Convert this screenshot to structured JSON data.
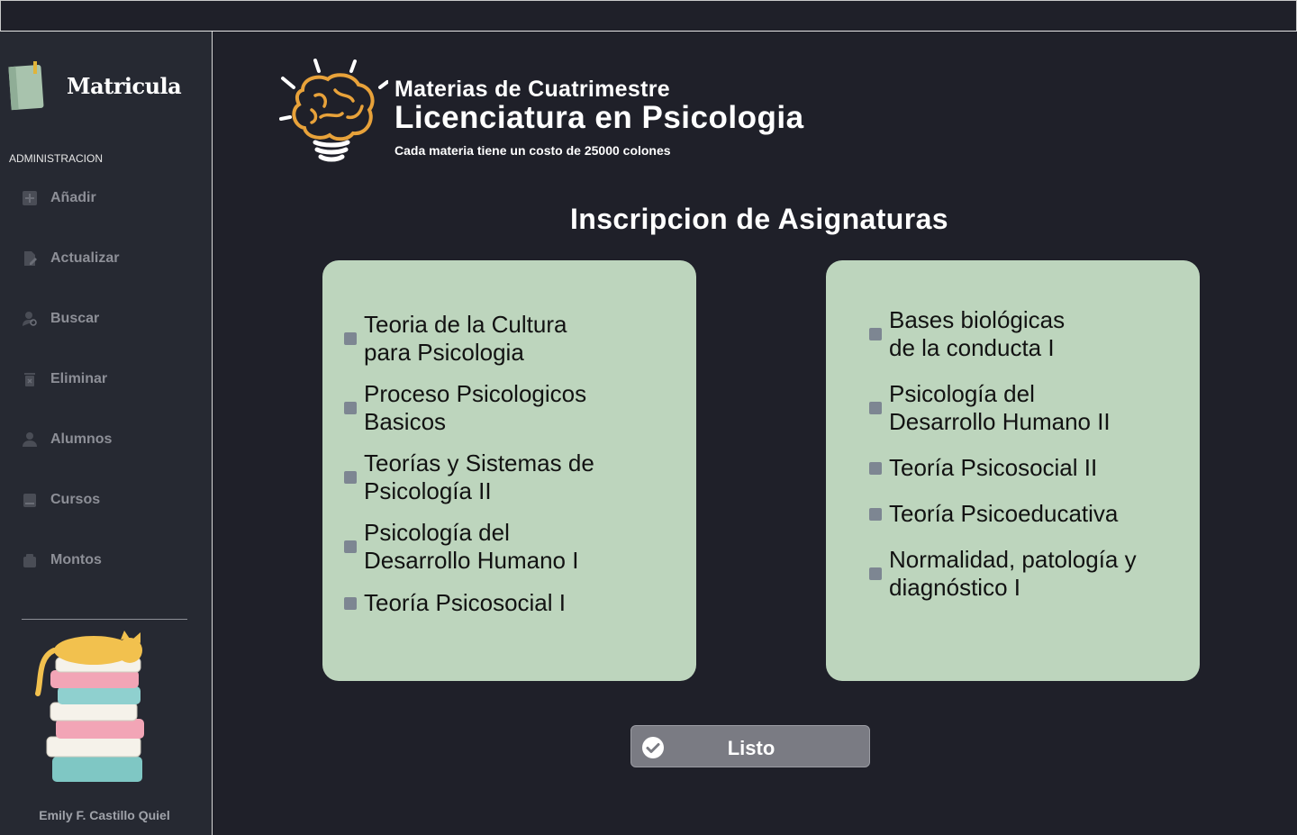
{
  "sidebar": {
    "brand": "Matricula",
    "section": "ADMINISTRACION",
    "items": [
      {
        "label": "Añadir",
        "icon": "add-icon"
      },
      {
        "label": "Actualizar",
        "icon": "edit-document-icon"
      },
      {
        "label": "Buscar",
        "icon": "user-search-icon"
      },
      {
        "label": "Eliminar",
        "icon": "trash-icon"
      },
      {
        "label": "Alumnos",
        "icon": "user-icon"
      },
      {
        "label": "Cursos",
        "icon": "book-icon"
      },
      {
        "label": "Montos",
        "icon": "wallet-icon"
      }
    ],
    "author": "Emily F. Castillo Quiel"
  },
  "header": {
    "subtitle": "Materias de Cuatrimestre",
    "title": "Licenciatura en Psicologia",
    "cost_note": "Cada materia tiene un costo de 25000 colones"
  },
  "main": {
    "title": "Inscripcion de Asignaturas",
    "left_subjects": [
      "Teoria de la Cultura\npara Psicologia",
      "Proceso Psicologicos\nBasicos",
      "Teorías y Sistemas de\nPsicología II",
      "Psicología del\nDesarrollo Humano I",
      "Teoría Psicosocial I"
    ],
    "right_subjects": [
      "Bases biológicas\nde la conducta I",
      "Psicología del\nDesarrollo Humano II",
      "Teoría Psicosocial II",
      "Teoría Psicoeducativa",
      "Normalidad, patología y\ndiagnóstico I"
    ],
    "done_label": "Listo"
  },
  "colors": {
    "background": "#1f2029",
    "sidebar": "#262932",
    "card": "#bdd5bd",
    "bullet": "#7d8692",
    "button": "#7a7b83",
    "accent_logo": "#e8a23a"
  }
}
